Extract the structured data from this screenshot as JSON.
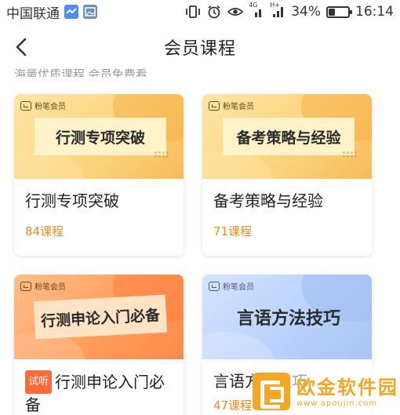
{
  "status_bar": {
    "carrier": "中国联通",
    "signal_labels": [
      "4G",
      "H+"
    ],
    "battery_percent": "34%",
    "battery_level": 0.34,
    "time": "16:14",
    "icons": [
      "app-notification-icon",
      "gallery-icon",
      "vibrate-icon",
      "alarm-icon",
      "eye-icon",
      "signal-4g-icon",
      "signal-h-plus-icon",
      "battery-icon"
    ]
  },
  "nav": {
    "title": "会员课程",
    "back_icon": "chevron-left-icon"
  },
  "subtitle": "海量优质课程,会员免费看",
  "courses": [
    {
      "brand": "粉笔会员",
      "thumb_text": "行测专项突破",
      "name": "行测专项突破",
      "count": "84课程",
      "theme": "yellow"
    },
    {
      "brand": "粉笔会员",
      "thumb_text": "备考策略与经验",
      "name": "备考策略与经验",
      "count": "71课程",
      "theme": "yellow"
    },
    {
      "brand": "粉笔会员",
      "thumb_text": "行测申论入门必备",
      "name": "行测申论入门必备",
      "badge": "试听",
      "theme": "orange"
    },
    {
      "brand": "粉笔会员",
      "thumb_text": "言语方法技巧",
      "name": "言语方法技巧",
      "count": "47课程",
      "theme": "blue"
    }
  ],
  "watermark": {
    "title": "欧金软件园",
    "url": "www.apoujin.com"
  },
  "colors": {
    "accent_orange": "#f08a1c",
    "badge_red": "#ff6a3c"
  }
}
